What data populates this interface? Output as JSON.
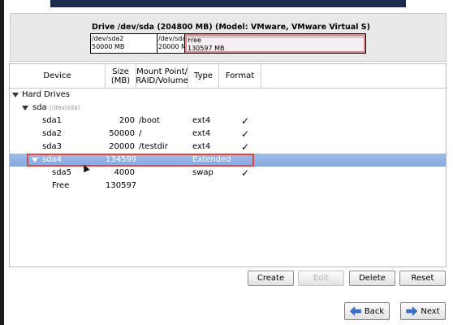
{
  "drive": {
    "title": "Drive /dev/sda (204800 MB) (Model: VMware, VMware Virtual S)",
    "segments": [
      {
        "name": "/dev/sda2",
        "size": "50000 MB"
      },
      {
        "name": "/dev/sda",
        "size": "20000 M"
      },
      {
        "name": "Free",
        "size": "130597 MB"
      }
    ]
  },
  "table": {
    "headers": {
      "device": "Device",
      "size": "Size\n(MB)",
      "mount": "Mount Point/\nRAID/Volume",
      "type": "Type",
      "format": "Format"
    },
    "group": "Hard Drives",
    "disk": {
      "label": "sda",
      "sublabel": "(/dev/sda)"
    },
    "rows": [
      {
        "device": "sda1",
        "size": "200",
        "mount": "/boot",
        "type": "ext4",
        "format": "✓"
      },
      {
        "device": "sda2",
        "size": "50000",
        "mount": "/",
        "type": "ext4",
        "format": "✓"
      },
      {
        "device": "sda3",
        "size": "20000",
        "mount": "/testdir",
        "type": "ext4",
        "format": "✓"
      },
      {
        "device": "sda4",
        "size": "134599",
        "mount": "",
        "type": "Extended",
        "format": ""
      },
      {
        "device": "sda5",
        "size": "4000",
        "mount": "",
        "type": "swap",
        "format": "✓"
      },
      {
        "device": "Free",
        "size": "130597",
        "mount": "",
        "type": "",
        "format": ""
      }
    ]
  },
  "buttons": {
    "create": "Create",
    "edit": "Edit",
    "delete": "Delete",
    "reset": "Reset",
    "back": "Back",
    "next": "Next"
  }
}
